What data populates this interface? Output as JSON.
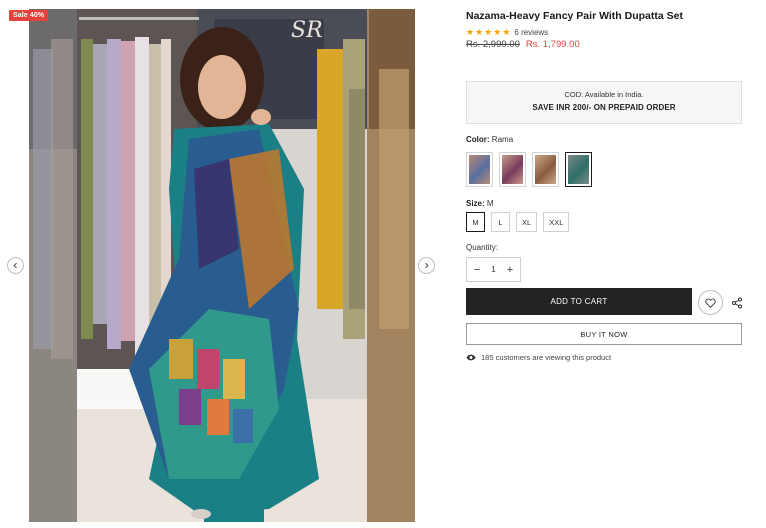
{
  "gallery": {
    "sale_badge": "Sale 40%",
    "prev_icon": "chevron-left-icon",
    "next_icon": "chevron-right-icon",
    "main_image_alt": "Model wearing teal embroidered suit with multicolor dupatta"
  },
  "product": {
    "title": "Nazama-Heavy Fancy Pair With Dupatta Set",
    "rating_stars": 5,
    "reviews_text": "6 reviews",
    "compare_price": "Rs. 2,999.00",
    "sale_price": "Rs. 1,799.00"
  },
  "promo": {
    "line1": "COD: Available in India.",
    "line2": "SAVE INR 200/- ON PREPAID ORDER"
  },
  "color": {
    "label": "Color:",
    "selected": "Rama",
    "swatches": [
      {
        "color": "#b88a78",
        "accent": "#5a6fa0"
      },
      {
        "color": "#c79b8a",
        "accent": "#7a3b5c"
      },
      {
        "color": "#c9a98c",
        "accent": "#8b5a3c"
      },
      {
        "color": "#7e8a86",
        "accent": "#2f6f6a"
      }
    ],
    "selected_index": 3
  },
  "size": {
    "label": "Size:",
    "selected": "M",
    "options": [
      "M",
      "L",
      "XL",
      "XXL"
    ]
  },
  "quantity": {
    "label": "Quantity:",
    "value": "1",
    "minus": "−",
    "plus": "+"
  },
  "actions": {
    "add_to_cart": "ADD TO CART",
    "buy_now": "BUY IT NOW",
    "wishlist_icon": "heart-icon",
    "share_icon": "share-icon"
  },
  "viewing": {
    "text": "185 customers are viewing this product",
    "icon": "eye-icon"
  },
  "colors": {
    "sale_red": "#e5413d",
    "button_dark": "#232323",
    "star_gold": "#f5a300"
  }
}
